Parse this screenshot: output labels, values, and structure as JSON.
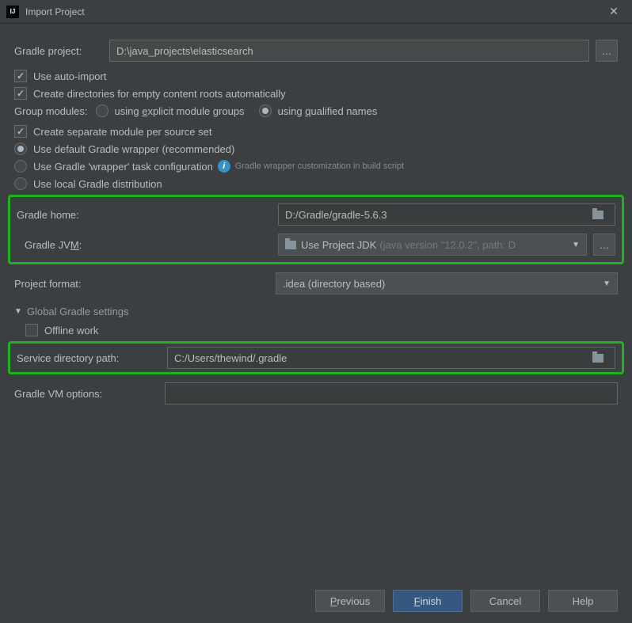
{
  "titlebar": {
    "title": "Import Project"
  },
  "gradle_project": {
    "label": "Gradle project:",
    "value": "D:\\java_projects\\elasticsearch"
  },
  "cb_auto_import": "Use auto-import",
  "cb_create_dirs": "Create directories for empty content roots automatically",
  "group_modules": {
    "label": "Group modules:",
    "opt1": "using explicit module groups",
    "opt2": "using qualified names"
  },
  "cb_separate_module": "Create separate module per source set",
  "wrapper": {
    "opt_default": "Use default Gradle wrapper (recommended)",
    "opt_task": "Use Gradle 'wrapper' task configuration",
    "info": "Gradle wrapper customization in build script",
    "opt_local": "Use local Gradle distribution"
  },
  "gradle_home": {
    "label": "Gradle home:",
    "value": "D:/Gradle/gradle-5.6.3"
  },
  "gradle_jvm": {
    "label": "Gradle JVM:",
    "value": "Use Project JDK",
    "hint": "(java version \"12.0.2\", path: D"
  },
  "project_format": {
    "label": "Project format:",
    "value": ".idea (directory based)"
  },
  "global_section": "Global Gradle settings",
  "cb_offline": "Offline work",
  "service_dir": {
    "label": "Service directory path:",
    "value": "C:/Users/thewind/.gradle"
  },
  "vm_options": {
    "label": "Gradle VM options:",
    "value": ""
  },
  "buttons": {
    "previous": "Previous",
    "finish": "Finish",
    "cancel": "Cancel",
    "help": "Help"
  }
}
